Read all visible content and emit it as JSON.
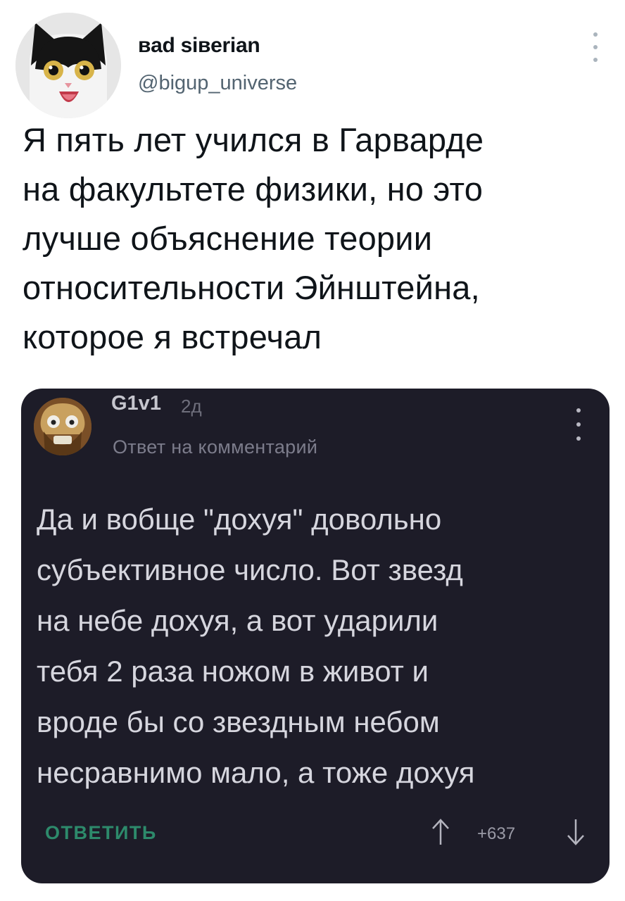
{
  "tweet": {
    "display_name": "вad siвerian",
    "handle": "@bigup_universe",
    "text": "Я пять лет учился в Гарварде\nна факультете физики, но это\nлучше объяснение теории\nотносительности Эйнштейна,\nкоторое я встречал",
    "avatar_icon": "cat-avatar-icon",
    "more_icon": "vertical-dots-icon"
  },
  "comment": {
    "author": "G1v1",
    "time": "2д",
    "reply_to_label": "Ответ на комментарий",
    "text": "Да и вобще \"дохуя\" довольно\nсубъективное число. Вот звезд\nна небе дохуя, а вот ударили\nтебя 2 раза ножом в живот и\nвроде бы со звездным небом\nнесравнимо мало, а тоже дохуя",
    "reply_button_label": "ОТВЕТИТЬ",
    "vote_count": "+637",
    "avatar_icon": "bearded-man-avatar-icon",
    "more_icon": "vertical-dots-icon",
    "upvote_icon": "arrow-up-icon",
    "downvote_icon": "arrow-down-icon"
  },
  "colors": {
    "card_background": "#1d1c28",
    "reply_green": "#2d8a6b",
    "handle_gray": "#536471"
  }
}
